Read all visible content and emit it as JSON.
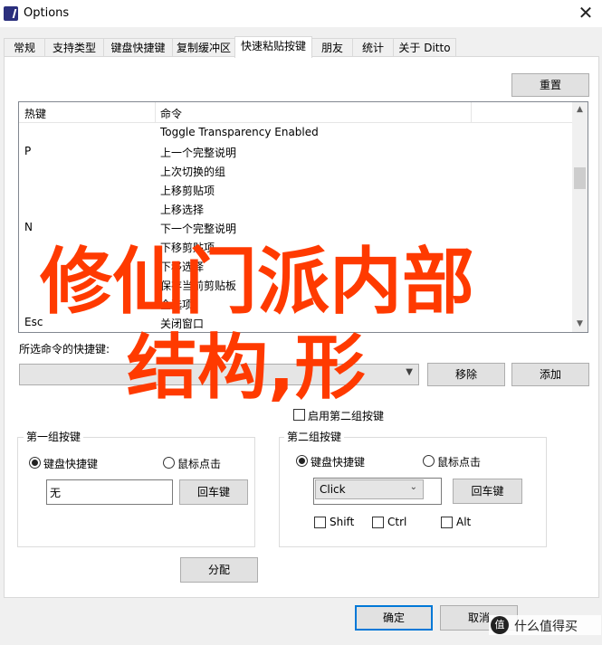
{
  "window": {
    "title": "Options",
    "close_glyph": "✕"
  },
  "tabs": [
    {
      "label": "常规",
      "active": false
    },
    {
      "label": "支持类型",
      "active": false
    },
    {
      "label": "键盘快捷键",
      "active": false
    },
    {
      "label": "复制缓冲区",
      "active": false
    },
    {
      "label": "快速粘贴按键",
      "active": true
    },
    {
      "label": "朋友",
      "active": false
    },
    {
      "label": "统计",
      "active": false
    },
    {
      "label": "关于 Ditto",
      "active": false
    }
  ],
  "reset_button": "重置",
  "list": {
    "headers": {
      "hotkey": "热键",
      "command": "命令"
    },
    "rows": [
      {
        "hotkey": "",
        "command": "Toggle Transparency Enabled"
      },
      {
        "hotkey": "P",
        "command": "上一个完整说明"
      },
      {
        "hotkey": "",
        "command": "上次切换的组"
      },
      {
        "hotkey": "",
        "command": "上移剪贴项"
      },
      {
        "hotkey": "",
        "command": "上移选择"
      },
      {
        "hotkey": "N",
        "command": "下一个完整说明"
      },
      {
        "hotkey": "",
        "command": "下移剪贴项"
      },
      {
        "hotkey": "",
        "command": "下移选择"
      },
      {
        "hotkey": "",
        "command": "保存当前剪贴板"
      },
      {
        "hotkey": "",
        "command": "全选项"
      },
      {
        "hotkey": "Esc",
        "command": "关闭窗口"
      }
    ]
  },
  "selected_command_label": "所选命令的快捷键:",
  "combo_value": "",
  "remove_button": "移除",
  "add_button": "添加",
  "enable_second_group_label": "启用第二组按键",
  "enable_second_group_checked": false,
  "group1": {
    "title": "第一组按键",
    "radio_keyboard": "键盘快捷键",
    "radio_mouse": "鼠标点击",
    "keyboard_selected": true,
    "input_value": "无",
    "enter_button": "回车键"
  },
  "group2": {
    "title": "第二组按键",
    "radio_keyboard": "键盘快捷键",
    "radio_mouse": "鼠标点击",
    "keyboard_selected": true,
    "click_value": "Click",
    "enter_button": "回车键",
    "shift_label": "Shift",
    "ctrl_label": "Ctrl",
    "alt_label": "Alt"
  },
  "assign_button": "分配",
  "ok_button": "确定",
  "cancel_button": "取消",
  "overlay": {
    "line1": "修仙门派内部",
    "line2": "结构,形",
    "color": "#ff3a00"
  },
  "watermark": {
    "logo_text": "值",
    "text": "什么值得买"
  }
}
